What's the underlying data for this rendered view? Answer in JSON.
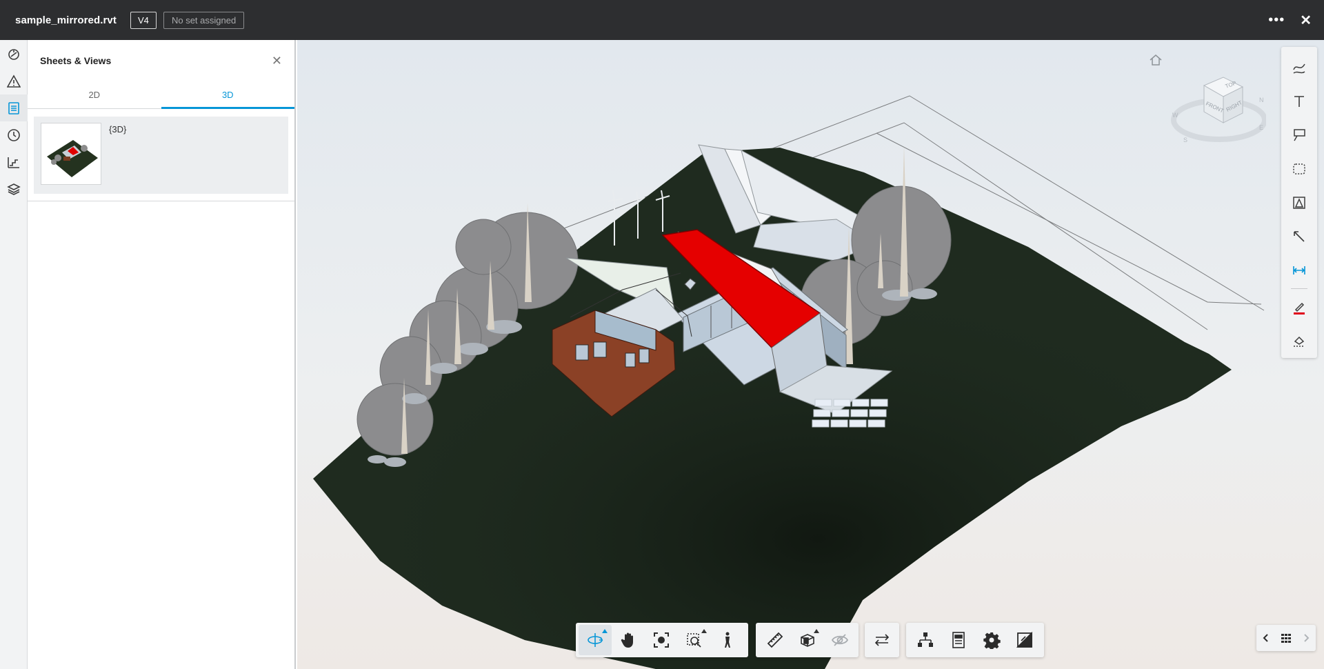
{
  "header": {
    "file_name": "sample_mirrored.rvt",
    "version": "V4",
    "set_status": "No set assigned",
    "more_icon": "more-icon",
    "close_icon": "close-icon"
  },
  "left_rail": {
    "items": [
      {
        "icon": "model-browser-icon"
      },
      {
        "icon": "issues-warning-icon"
      },
      {
        "icon": "sheets-views-icon"
      },
      {
        "icon": "history-clock-icon"
      },
      {
        "icon": "levels-icon"
      },
      {
        "icon": "layers-icon"
      }
    ]
  },
  "panel": {
    "title": "Sheets & Views",
    "tabs": [
      {
        "label": "2D",
        "active": false
      },
      {
        "label": "3D",
        "active": true
      }
    ],
    "views": [
      {
        "label": "{3D}"
      }
    ]
  },
  "viewcube": {
    "faces": {
      "top": "TOP",
      "front": "FRONT",
      "right": "RIGHT"
    },
    "compass": {
      "n": "N",
      "e": "E",
      "s": "S",
      "w": "W"
    }
  },
  "markup_tools": [
    {
      "icon": "freehand-pen-icon"
    },
    {
      "icon": "text-icon"
    },
    {
      "icon": "callout-icon"
    },
    {
      "icon": "cloud-shape-icon"
    },
    {
      "icon": "polygon-area-icon"
    },
    {
      "icon": "arrow-icon"
    },
    {
      "icon": "dimension-icon"
    },
    {
      "icon": "stroke-color-icon",
      "color": "#e0001b"
    },
    {
      "icon": "fill-icon"
    }
  ],
  "bottom_toolbar": {
    "groups": [
      [
        "orbit-icon",
        "pan-icon",
        "fit-view-icon",
        "zoom-window-icon",
        "first-person-icon"
      ],
      [
        "measure-icon",
        "section-box-icon",
        "visibility-icon"
      ],
      [
        "compare-icon"
      ],
      [
        "model-tree-icon",
        "properties-icon",
        "settings-icon",
        "fullscreen-icon"
      ]
    ]
  },
  "sheet_nav": {
    "prev_icon": "chevron-left-icon",
    "grid_icon": "grid-icon",
    "next_icon": "chevron-right-icon"
  },
  "colors": {
    "accent": "#0696d7",
    "topbar": "#2d2e30",
    "roof": "#e50000",
    "terrain": "#1f2b1f",
    "cladding": "#8b4126"
  }
}
